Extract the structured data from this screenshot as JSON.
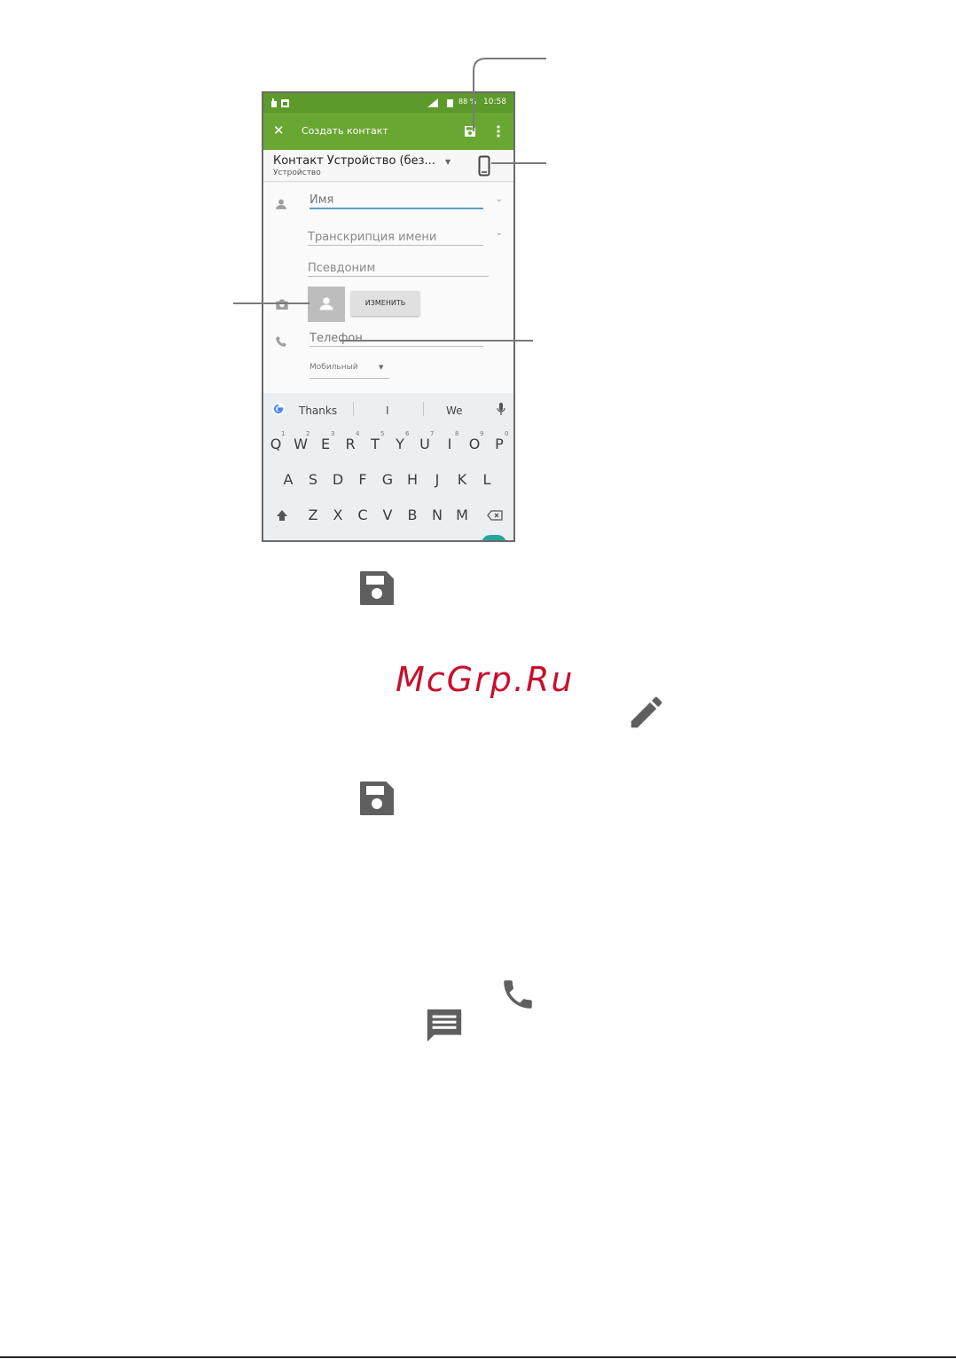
{
  "phone": {
    "status": {
      "battery": "88 %",
      "time": "10:58"
    },
    "toolbar": {
      "title": "Создать контакт"
    },
    "account": {
      "name": "Контакт Устройство (без...",
      "type": "Устройство"
    },
    "fields": {
      "name": "Имя",
      "transcription": "Транскрипция имени",
      "nickname": "Псевдоним",
      "change_button": "ИЗМЕНИТЬ",
      "phone": "Телефон",
      "phone_type": "Мобильный"
    },
    "suggestions": [
      "Thanks",
      "I",
      "We"
    ],
    "keyboard": {
      "row1": [
        "Q",
        "W",
        "E",
        "R",
        "T",
        "Y",
        "U",
        "I",
        "O",
        "P"
      ],
      "row1_digits": [
        "1",
        "2",
        "3",
        "4",
        "5",
        "6",
        "7",
        "8",
        "9",
        "0"
      ],
      "row2": [
        "A",
        "S",
        "D",
        "F",
        "G",
        "H",
        "J",
        "K",
        "L"
      ],
      "row3": [
        "Z",
        "X",
        "C",
        "V",
        "B",
        "N",
        "M"
      ]
    }
  },
  "watermark": "McGrp.Ru",
  "icons": {
    "save": "save-icon",
    "edit": "pencil-icon",
    "call": "phone-icon",
    "message": "message-icon",
    "accent": "#6aa632",
    "icon_color": "#5f5f5f"
  }
}
